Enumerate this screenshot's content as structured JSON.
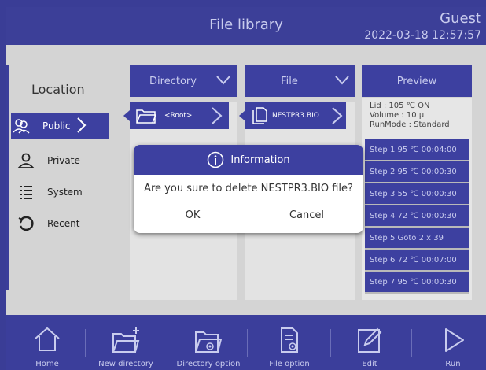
{
  "header": {
    "title": "File library",
    "user": "Guest",
    "datetime": "2022-03-18 12:57:57"
  },
  "location": {
    "title": "Location",
    "items": [
      {
        "label": "Public",
        "icon": "users-icon",
        "active": true
      },
      {
        "label": "Private",
        "icon": "user-icon",
        "active": false
      },
      {
        "label": "System",
        "icon": "list-icon",
        "active": false
      },
      {
        "label": "Recent",
        "icon": "history-icon",
        "active": false
      }
    ]
  },
  "directory": {
    "header_label": "Directory",
    "path": "<Root>"
  },
  "file": {
    "header_label": "File",
    "selected": "NESTPR3.BIO"
  },
  "preview": {
    "header_label": "Preview",
    "info": [
      "Lid : 105 ℃ ON",
      "Volume : 10 µl",
      "RunMode : Standard"
    ],
    "steps": [
      "Step 1  95 ℃ 00:04:00",
      "Step 2  95 ℃ 00:00:30",
      "Step 3  55 ℃ 00:00:30",
      "Step 4  72 ℃ 00:00:30",
      "Step 5    Goto 2    x 39",
      "Step 6  72 ℃ 00:07:00",
      "Step 7  95 ℃ 00:00:30"
    ]
  },
  "dialog": {
    "title": "Information",
    "message": "Are you sure to delete  NESTPR3.BIO  file?",
    "ok_label": "OK",
    "cancel_label": "Cancel"
  },
  "footer": {
    "buttons": [
      {
        "label": "Home",
        "icon": "home-icon"
      },
      {
        "label": "New directory",
        "icon": "new-folder-icon"
      },
      {
        "label": "Directory option",
        "icon": "folder-settings-icon"
      },
      {
        "label": "File option",
        "icon": "file-settings-icon"
      },
      {
        "label": "Edit",
        "icon": "edit-icon"
      },
      {
        "label": "Run",
        "icon": "play-icon"
      }
    ]
  },
  "colors": {
    "brand": "#3d40a0",
    "background": "#d4d4d4",
    "header_text": "#c9ccee"
  }
}
